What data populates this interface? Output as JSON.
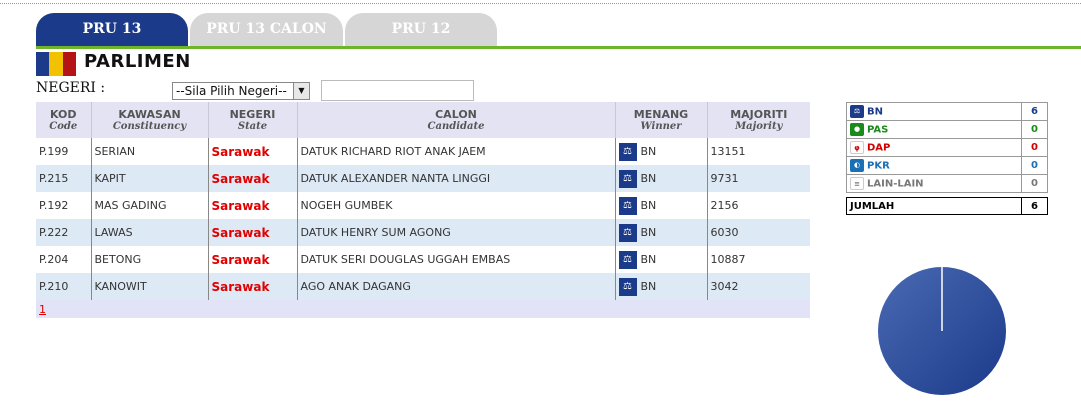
{
  "tabs": [
    {
      "label": "PRU 13",
      "active": true
    },
    {
      "label": "PRU 13 CALON",
      "active": false
    },
    {
      "label": "PRU 12",
      "active": false
    }
  ],
  "title": "PARLIMEN",
  "filter": {
    "negeri_label": "NEGERI :",
    "select_value": "--Sila Pilih Negeri--"
  },
  "table": {
    "columns": [
      {
        "main": "KOD",
        "sub": "Code"
      },
      {
        "main": "KAWASAN",
        "sub": "Constituency"
      },
      {
        "main": "NEGERI",
        "sub": "State"
      },
      {
        "main": "CALON",
        "sub": "Candidate"
      },
      {
        "main": "MENANG",
        "sub": "Winner"
      },
      {
        "main": "MAJORITI",
        "sub": "Majority"
      }
    ],
    "rows": [
      {
        "code": "P.199",
        "constituency": "SERIAN",
        "state": "Sarawak",
        "candidate": "DATUK RICHARD RIOT ANAK JAEM",
        "winner": "BN",
        "majority": "13151"
      },
      {
        "code": "P.215",
        "constituency": "KAPIT",
        "state": "Sarawak",
        "candidate": "DATUK ALEXANDER NANTA LINGGI",
        "winner": "BN",
        "majority": "9731"
      },
      {
        "code": "P.192",
        "constituency": "MAS GADING",
        "state": "Sarawak",
        "candidate": "NOGEH GUMBEK",
        "winner": "BN",
        "majority": "2156"
      },
      {
        "code": "P.222",
        "constituency": "LAWAS",
        "state": "Sarawak",
        "candidate": "DATUK HENRY SUM AGONG",
        "winner": "BN",
        "majority": "6030"
      },
      {
        "code": "P.204",
        "constituency": "BETONG",
        "state": "Sarawak",
        "candidate": "DATUK SERI DOUGLAS UGGAH EMBAS",
        "winner": "BN",
        "majority": "10887"
      },
      {
        "code": "P.210",
        "constituency": "KANOWIT",
        "state": "Sarawak",
        "candidate": "AGO ANAK DAGANG",
        "winner": "BN",
        "majority": "3042"
      }
    ],
    "pages": [
      "1"
    ]
  },
  "parties": [
    {
      "name": "BN",
      "count": "6",
      "color": "#1b3a8a",
      "count_color": "#1b3a8a",
      "logo_bg": "#1b3a8a",
      "logo_icon": "scales-icon"
    },
    {
      "name": "PAS",
      "count": "0",
      "color": "#1a8a1a",
      "count_color": "#1a8a1a",
      "logo_bg": "#1a8a1a",
      "logo_icon": "moon-icon"
    },
    {
      "name": "DAP",
      "count": "0",
      "color": "#d00000",
      "count_color": "#d00000",
      "logo_bg": "#ffffff",
      "logo_icon": "rocket-icon"
    },
    {
      "name": "PKR",
      "count": "0",
      "color": "#1a6fb5",
      "count_color": "#1a6fb5",
      "logo_bg": "#1a6fb5",
      "logo_icon": "eye-icon"
    },
    {
      "name": "LAIN-LAIN",
      "count": "0",
      "color": "#777777",
      "count_color": "#777777",
      "logo_bg": "#ffffff",
      "logo_icon": "lain-lain-icon"
    }
  ],
  "total": {
    "label": "JUMLAH",
    "count": "6"
  },
  "pie": {
    "slices": [
      {
        "party": "BN",
        "value": 6,
        "color": "#1b3a8a"
      }
    ]
  },
  "colors": {
    "tab_active": "#1b3a8a",
    "tab_inactive": "#d6d6d6",
    "accent_line": "#6fb52c",
    "state_text": "#e00000",
    "row_alt": "#dde9f5",
    "header_bg": "#e3e3f3"
  }
}
